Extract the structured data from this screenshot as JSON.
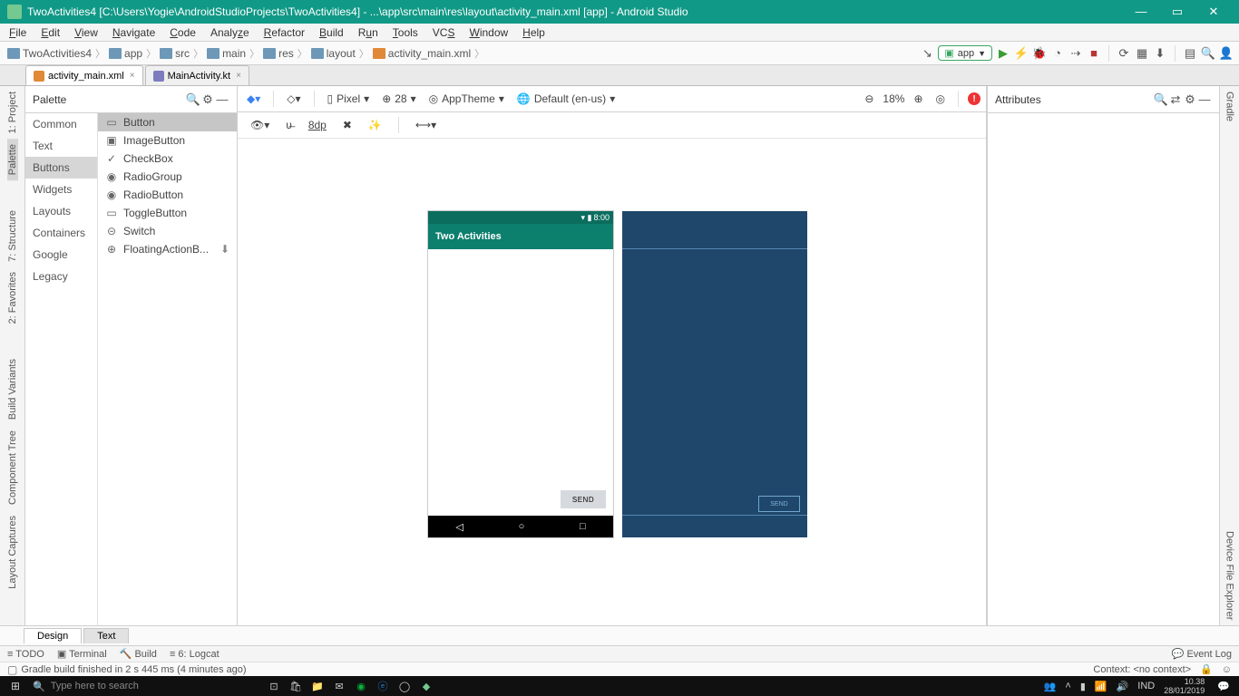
{
  "title": "TwoActivities4 [C:\\Users\\Yogie\\AndroidStudioProjects\\TwoActivities4] - ...\\app\\src\\main\\res\\layout\\activity_main.xml [app] - Android Studio",
  "menu": [
    "File",
    "Edit",
    "View",
    "Navigate",
    "Code",
    "Analyze",
    "Refactor",
    "Build",
    "Run",
    "Tools",
    "VCS",
    "Window",
    "Help"
  ],
  "breadcrumbs": [
    "TwoActivities4",
    "app",
    "src",
    "main",
    "res",
    "layout",
    "activity_main.xml"
  ],
  "run_config": "app",
  "editor_tabs": [
    {
      "name": "activity_main.xml",
      "active": true,
      "kind": "xml"
    },
    {
      "name": "MainActivity.kt",
      "active": false,
      "kind": "kt"
    }
  ],
  "palette": {
    "title": "Palette",
    "categories": [
      "Common",
      "Text",
      "Buttons",
      "Widgets",
      "Layouts",
      "Containers",
      "Google",
      "Legacy"
    ],
    "selected_category": "Buttons",
    "items": [
      "Button",
      "ImageButton",
      "CheckBox",
      "RadioGroup",
      "RadioButton",
      "ToggleButton",
      "Switch",
      "FloatingActionB..."
    ],
    "selected_item": "Button"
  },
  "design_toolbar": {
    "device": "Pixel",
    "api": "28",
    "theme": "AppTheme",
    "locale": "Default (en-us)",
    "zoom": "18%",
    "margin": "8dp"
  },
  "preview": {
    "status_time": "8:00",
    "app_title": "Two Activities",
    "button_label": "SEND"
  },
  "attributes": {
    "title": "Attributes"
  },
  "bottom_modes": {
    "design": "Design",
    "text": "Text"
  },
  "tool_windows_left": [
    "1: Project",
    "Palette",
    "7: Structure",
    "2: Favorites",
    "Build Variants",
    "Component Tree",
    "Layout Captures"
  ],
  "tool_windows_right": [
    "Gradle",
    "Device File Explorer"
  ],
  "bottom_tool_windows": [
    "TODO",
    "Terminal",
    "Build",
    "6: Logcat"
  ],
  "event_log": "Event Log",
  "status_msg": "Gradle build finished in 2 s 445 ms (4 minutes ago)",
  "context_label": "Context: <no context>",
  "taskbar": {
    "search_placeholder": "Type here to search",
    "ime": "IND",
    "time": "10.38",
    "date": "28/01/2019"
  }
}
